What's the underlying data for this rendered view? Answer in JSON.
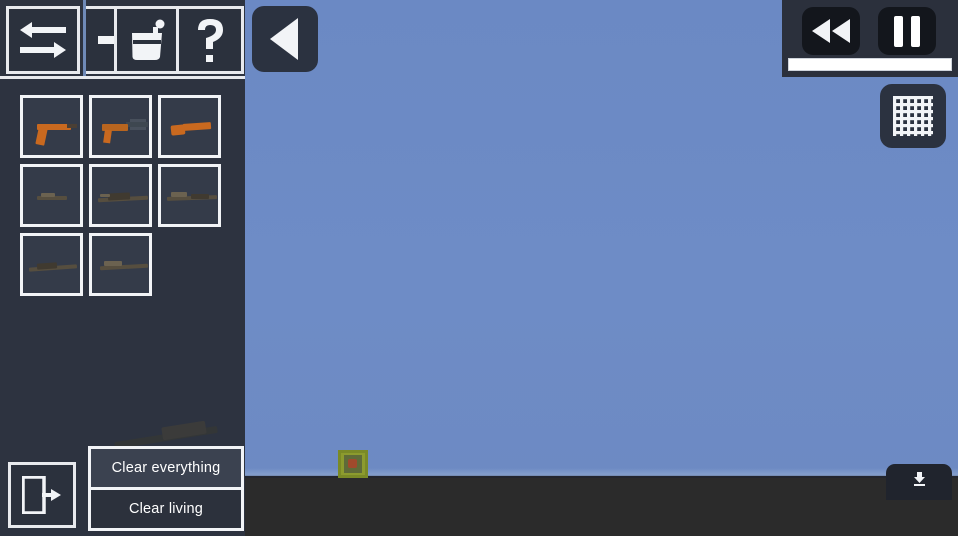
{
  "app": {
    "title": "Sandbox Weapon Editor",
    "scene": {
      "sky_color": "#6b89c4",
      "ground_color": "#2b2b2b",
      "object_label": "crate",
      "object_color": "#8c9b2e"
    }
  },
  "toolbar": {
    "buttons": [
      {
        "id": "swap",
        "icon": "swap-arrows-icon",
        "label": "Swap"
      },
      {
        "id": "move",
        "icon": "arrow-right-icon",
        "label": "Move"
      },
      {
        "id": "paint",
        "icon": "paint-bucket-icon",
        "label": "Paint"
      },
      {
        "id": "help",
        "icon": "question-mark-icon",
        "label": "Help"
      }
    ]
  },
  "back_button": {
    "icon": "left-triangle-icon",
    "label": "Back"
  },
  "inventory": {
    "title": "Weapons",
    "columns": 3,
    "items": [
      {
        "index": 0,
        "name": "pistol",
        "style": "pistol",
        "selected": false
      },
      {
        "index": 1,
        "name": "submachine-gun",
        "style": "smg",
        "selected": false
      },
      {
        "index": 2,
        "name": "sawed-off-shotgun",
        "style": "sawedoff",
        "selected": false
      },
      {
        "index": 3,
        "name": "carbine",
        "style": "rifle-a",
        "selected": false
      },
      {
        "index": 4,
        "name": "assault-rifle",
        "style": "rifle-b",
        "selected": false
      },
      {
        "index": 5,
        "name": "battle-rifle",
        "style": "rifle-c",
        "selected": false
      },
      {
        "index": 6,
        "name": "sniper-rifle",
        "style": "rifle-d",
        "selected": false
      },
      {
        "index": 7,
        "name": "marksman-rifle",
        "style": "rifle-e",
        "selected": false
      }
    ]
  },
  "exit_button": {
    "icon": "exit-door-icon",
    "label": "Exit"
  },
  "context_menu": {
    "items": [
      {
        "id": "clear-everything",
        "label": "Clear everything",
        "highlighted": true
      },
      {
        "id": "clear-living",
        "label": "Clear living",
        "highlighted": false
      }
    ]
  },
  "playback": {
    "rewind": {
      "icon": "rewind-icon",
      "label": "Rewind"
    },
    "pause": {
      "icon": "pause-icon",
      "label": "Pause"
    },
    "slider": {
      "name": "time-slider",
      "value": 100,
      "fill_color": "#ffffff"
    }
  },
  "grid_toggle": {
    "icon": "grid-mesh-icon",
    "label": "Toggle grid"
  },
  "bottom_right_tab": {
    "icon": "download-icon",
    "label": "Download"
  }
}
